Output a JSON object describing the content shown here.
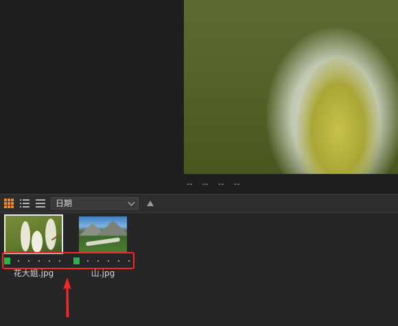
{
  "preview": {
    "meta": [
      "--",
      "--",
      "--",
      "--"
    ]
  },
  "toolbar": {
    "view_modes": [
      {
        "name": "thumbnail-grid",
        "active": true,
        "color": "#f08a24"
      },
      {
        "name": "list",
        "active": false
      },
      {
        "name": "details",
        "active": false
      }
    ],
    "sort_by": "日期",
    "sort_direction": "ascending"
  },
  "thumbnails": [
    {
      "name": "花大姐.jpg",
      "selected": true,
      "color_label": "#2db34a",
      "rating_dots": 5
    },
    {
      "name": "山.jpg",
      "selected": false,
      "color_label": "#2db34a",
      "rating_dots": 5
    }
  ],
  "annotation": {
    "highlight_color": "#ff2424"
  }
}
